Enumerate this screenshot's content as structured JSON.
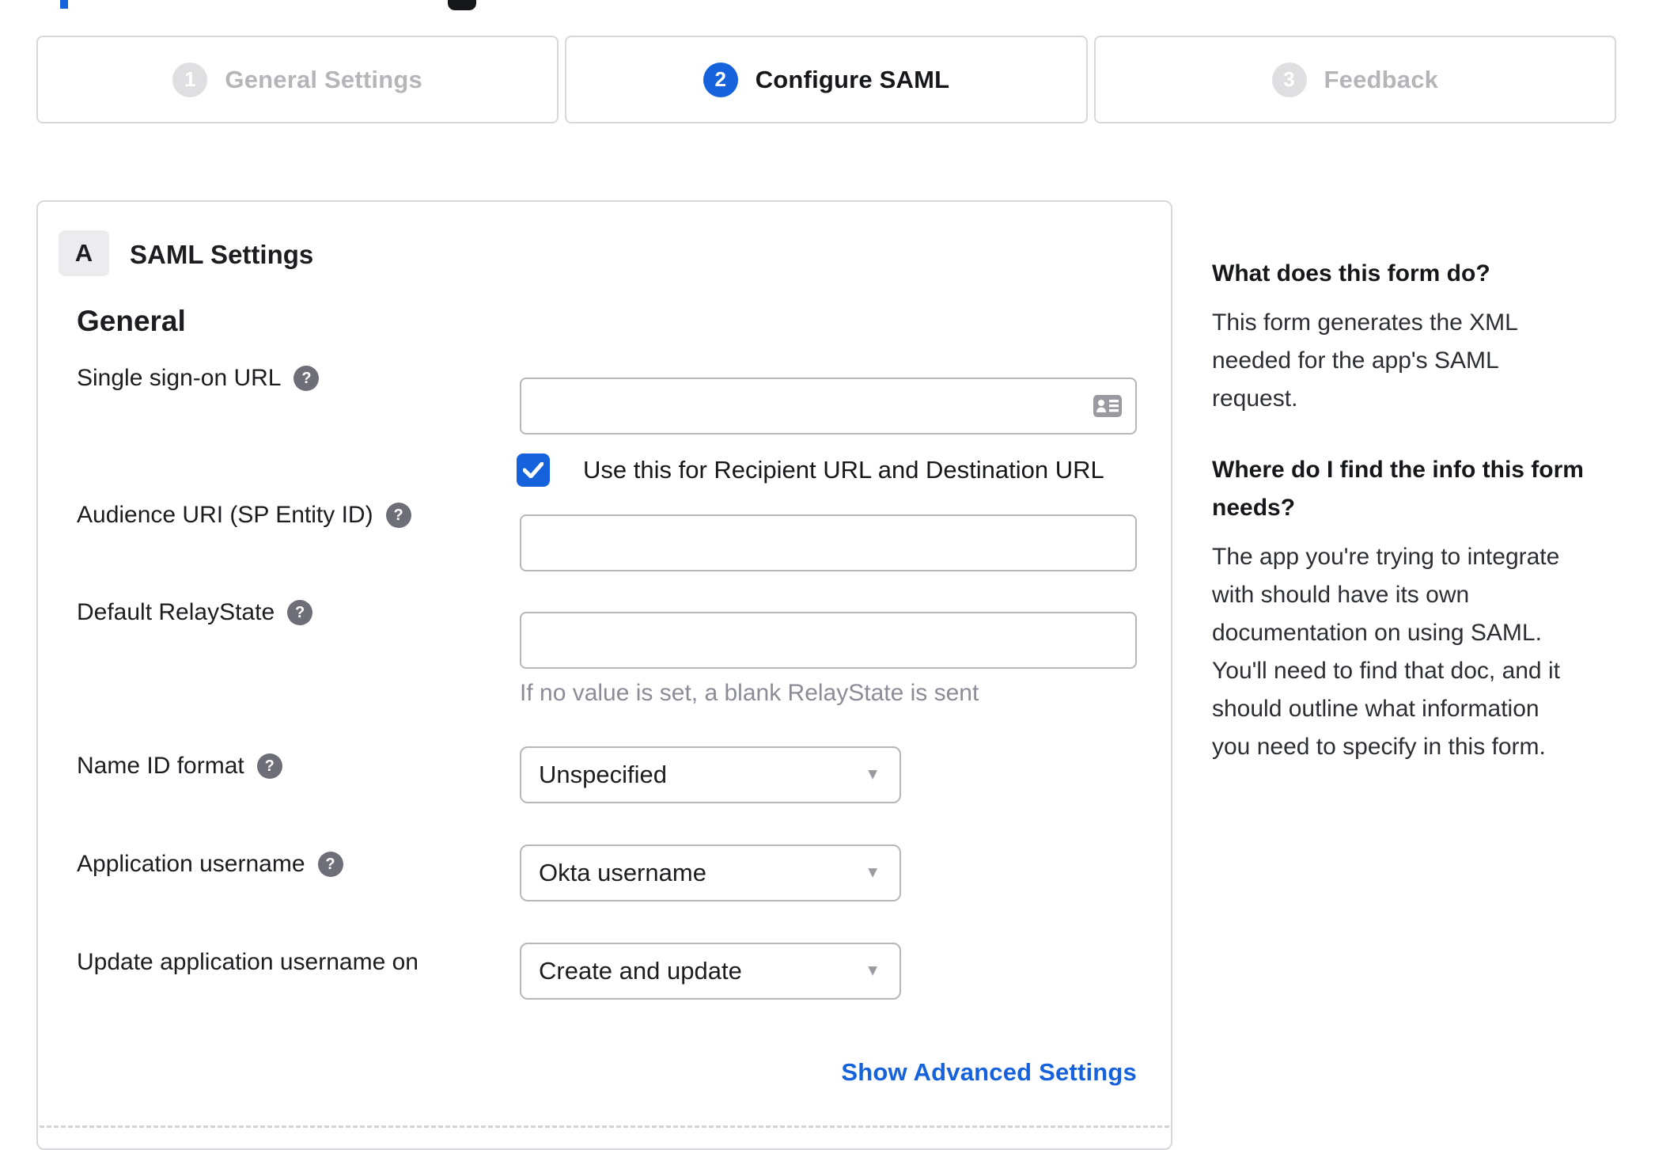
{
  "stepper": {
    "steps": [
      {
        "number": "1",
        "label": "General Settings",
        "state": "inactive"
      },
      {
        "number": "2",
        "label": "Configure SAML",
        "state": "active"
      },
      {
        "number": "3",
        "label": "Feedback",
        "state": "inactive"
      }
    ]
  },
  "panel": {
    "badge": "A",
    "title": "SAML Settings",
    "general_heading": "General",
    "fields": {
      "sso_url": {
        "label": "Single sign-on URL",
        "value": ""
      },
      "sso_checkbox": {
        "label": "Use this for Recipient URL and Destination URL",
        "checked": true
      },
      "audience_uri": {
        "label": "Audience URI (SP Entity ID)",
        "value": ""
      },
      "default_relaystate": {
        "label": "Default RelayState",
        "value": "",
        "hint": "If no value is set, a blank RelayState is sent"
      },
      "name_id_format": {
        "label": "Name ID format",
        "value": "Unspecified"
      },
      "application_username": {
        "label": "Application username",
        "value": "Okta username"
      },
      "update_app_username": {
        "label": "Update application username on",
        "value": "Create and update"
      }
    },
    "advanced_link": "Show Advanced Settings"
  },
  "sidebar": {
    "sections": [
      {
        "heading": "What does this form do?",
        "body": "This form generates the XML needed for the app's SAML request."
      },
      {
        "heading": "Where do I find the info this form needs?",
        "body": "The app you're trying to integrate with should have its own documentation on using SAML. You'll need to find that doc, and it should outline what information you need to specify in this form."
      }
    ]
  },
  "icons": {
    "help_glyph": "?",
    "caret_glyph": "▼"
  },
  "colors": {
    "accent": "#1662dd",
    "panel_border": "#d8d8dc",
    "input_border": "#b6b6bc",
    "text": "#1d1d21",
    "muted": "#8c8c96",
    "step_inactive": "#b5b5ba"
  }
}
